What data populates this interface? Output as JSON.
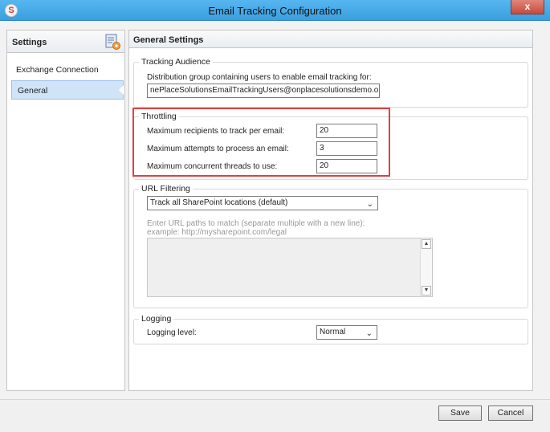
{
  "window": {
    "title": "Email Tracking Configuration",
    "app_icon_glyph": "S",
    "close_glyph": "x"
  },
  "sidebar": {
    "title": "Settings",
    "icon": "settings-document-icon",
    "items": [
      {
        "label": "Exchange Connection",
        "selected": false
      },
      {
        "label": "General",
        "selected": true
      }
    ]
  },
  "main": {
    "title": "General Settings",
    "tracking_audience": {
      "legend": "Tracking Audience",
      "label": "Distribution group containing users to enable email tracking for:",
      "value": "nePlaceSolutionsEmailTrackingUsers@onplacesolutionsdemo.onmicrosoft.com"
    },
    "throttling": {
      "legend": "Throttling",
      "fields": [
        {
          "label": "Maximum recipients to track per email:",
          "value": "20"
        },
        {
          "label": "Maximum attempts to process an email:",
          "value": "3"
        },
        {
          "label": "Maximum concurrent threads to use:",
          "value": "20"
        }
      ]
    },
    "url_filtering": {
      "legend": "URL Filtering",
      "selected": "Track all SharePoint locations (default)",
      "hint_line1": "Enter URL paths to match (separate multiple with a new line):",
      "hint_line2": "example: http://mysharepoint.com/legal"
    },
    "logging": {
      "legend": "Logging",
      "label": "Logging level:",
      "selected": "Normal"
    }
  },
  "footer": {
    "save_label": "Save",
    "cancel_label": "Cancel"
  },
  "colors": {
    "titlebar": "#3a9fdf",
    "selected_item": "#cfe4f7",
    "highlight_box": "#e04040",
    "close_button": "#c74b3a"
  }
}
